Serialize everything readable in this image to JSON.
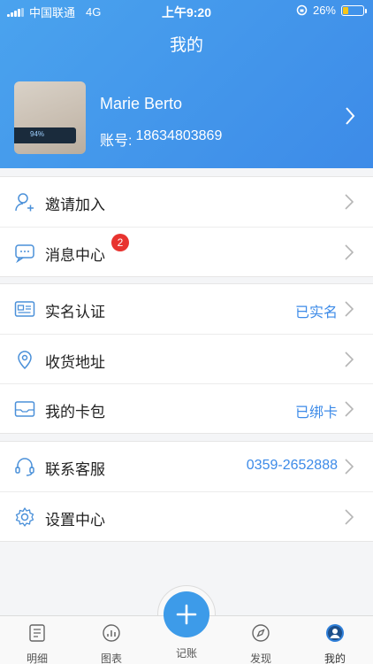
{
  "status_bar": {
    "carrier": "中国联通",
    "network": "4G",
    "time": "上午9:20",
    "battery_text": "26%",
    "battery_level": 0.26
  },
  "header": {
    "title": "我的"
  },
  "profile": {
    "name": "Marie Berto",
    "account_label": "账号:",
    "account_number": "18634803869",
    "avatar_overlay_text": "94%"
  },
  "menu_groups": {
    "group1": {
      "invite": {
        "label": "邀请加入",
        "icon": "add-user-icon"
      },
      "messages": {
        "label": "消息中心",
        "icon": "message-icon",
        "badge": "2"
      }
    },
    "group2": {
      "verify": {
        "label": "实名认证",
        "value": "已实名",
        "icon": "id-card-icon"
      },
      "address": {
        "label": "收货地址",
        "icon": "location-pin-icon"
      },
      "wallet": {
        "label": "我的卡包",
        "value": "已绑卡",
        "icon": "card-wallet-icon"
      }
    },
    "group3": {
      "support": {
        "label": "联系客服",
        "value": "0359-2652888",
        "icon": "headset-icon"
      },
      "settings": {
        "label": "设置中心",
        "icon": "gear-icon"
      }
    }
  },
  "tabbar": {
    "details": "明细",
    "charts": "图表",
    "record": "记账",
    "discover": "发现",
    "mine": "我的"
  },
  "colors": {
    "accent": "#3d8be8",
    "badge": "#e8332f",
    "fab": "#3d9be9"
  }
}
